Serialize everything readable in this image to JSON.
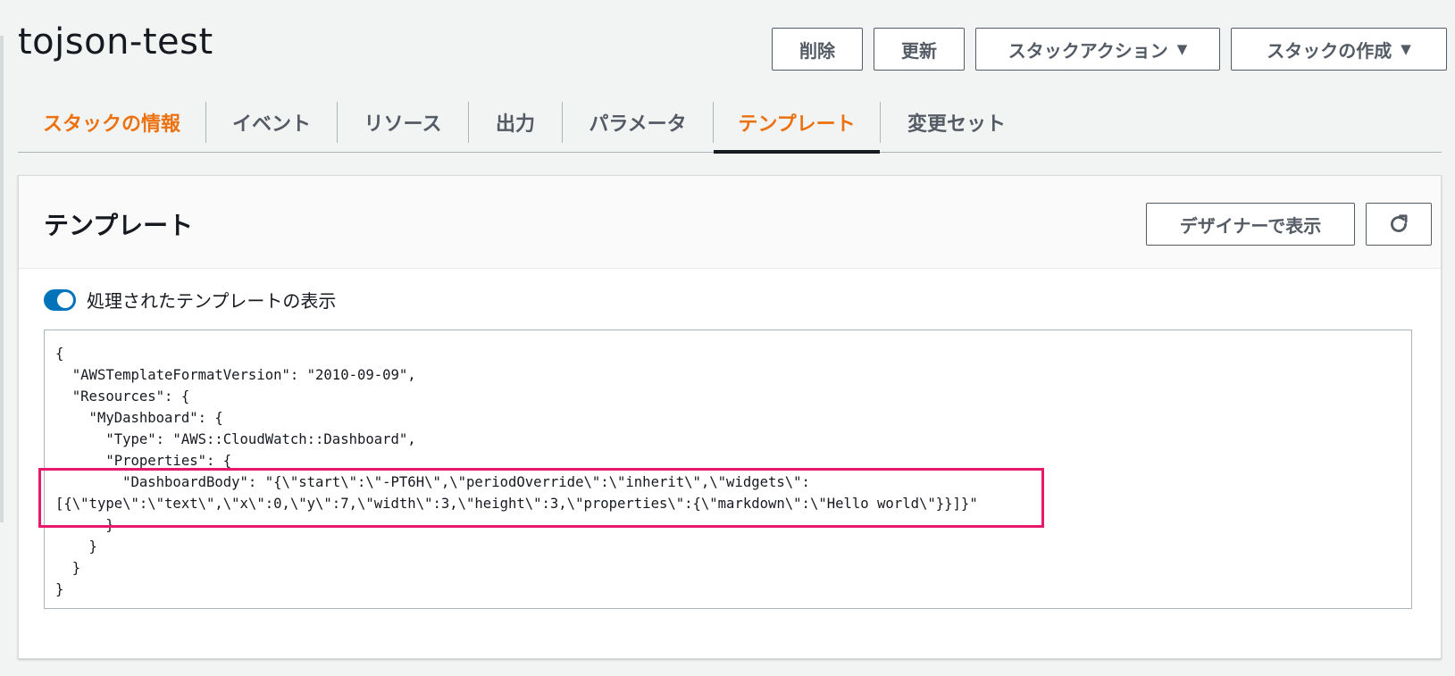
{
  "stack": {
    "name": "tojson-test"
  },
  "header_actions": {
    "delete_label": "削除",
    "update_label": "更新",
    "stack_actions_label": "スタックアクション",
    "create_stack_label": "スタックの作成"
  },
  "tabs": [
    {
      "label": "スタックの情報"
    },
    {
      "label": "イベント"
    },
    {
      "label": "リソース"
    },
    {
      "label": "出力"
    },
    {
      "label": "パラメータ"
    },
    {
      "label": "テンプレート"
    },
    {
      "label": "変更セット"
    }
  ],
  "panel": {
    "title": "テンプレート",
    "designer_label": "デザイナーで表示",
    "toggle_label": "処理されたテンプレートの表示",
    "toggle_on": true
  },
  "template_lines": [
    "{",
    "  \"AWSTemplateFormatVersion\": \"2010-09-09\",",
    "  \"Resources\": {",
    "    \"MyDashboard\": {",
    "      \"Type\": \"AWS::CloudWatch::Dashboard\",",
    "      \"Properties\": {",
    "        \"DashboardBody\": \"{\\\"start\\\":\\\"-PT6H\\\",\\\"periodOverride\\\":\\\"inherit\\\",\\\"widgets\\\":",
    "[{\\\"type\\\":\\\"text\\\",\\\"x\\\":0,\\\"y\\\":7,\\\"width\\\":3,\\\"height\\\":3,\\\"properties\\\":{\\\"markdown\\\":\\\"Hello world\\\"}}]}\"",
    "      }",
    "    }",
    "  }",
    "}"
  ],
  "colors": {
    "accent_orange": "#ec7211",
    "toggle_blue": "#0073bb",
    "highlight_pink": "#e8196a"
  }
}
